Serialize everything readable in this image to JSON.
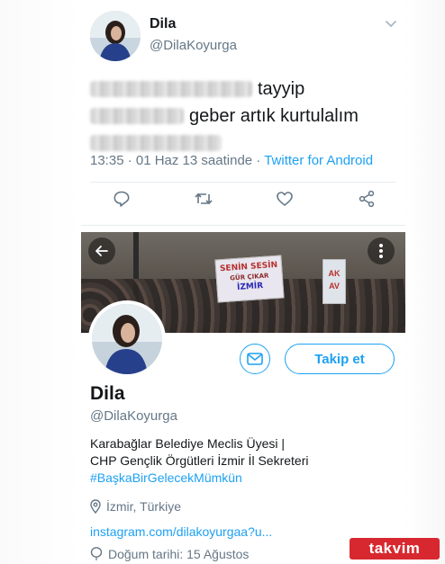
{
  "tweet": {
    "author_name": "Dila",
    "author_handle": "@DilaKoyurga",
    "line1_visible": "tayyip",
    "line2_visible": "geber artık kurtulalım",
    "timestamp": "13:35 · 01 Haz 13 saatinde · ",
    "via": "Twitter for Android",
    "icons": [
      "reply-icon",
      "retweet-icon",
      "like-icon",
      "share-icon"
    ]
  },
  "profile": {
    "banner_sign_1": [
      "SENİN SESİN",
      "GÜR ÇIKAR",
      "İZMİR"
    ],
    "banner_sign_2": [
      "AK",
      "AV"
    ],
    "follow_label": "Takip et",
    "name": "Dila",
    "handle": "@DilaKoyurga",
    "bio_line1": "Karabağlar Belediye Meclis Üyesi |",
    "bio_line2": "CHP Gençlik Örgütleri İzmir İl Sekreteri",
    "bio_hashtag": "#BaşkaBirGelecekMümkün",
    "location": "İzmir, Türkiye",
    "website": "instagram.com/dilakoyurgaa?u...",
    "birthday": "Doğum tarihi: 15 Ağustos"
  },
  "watermark": "takvim",
  "colors": {
    "accent": "#1da1f2",
    "secondary_text": "#657786",
    "watermark": "#d8282f"
  }
}
